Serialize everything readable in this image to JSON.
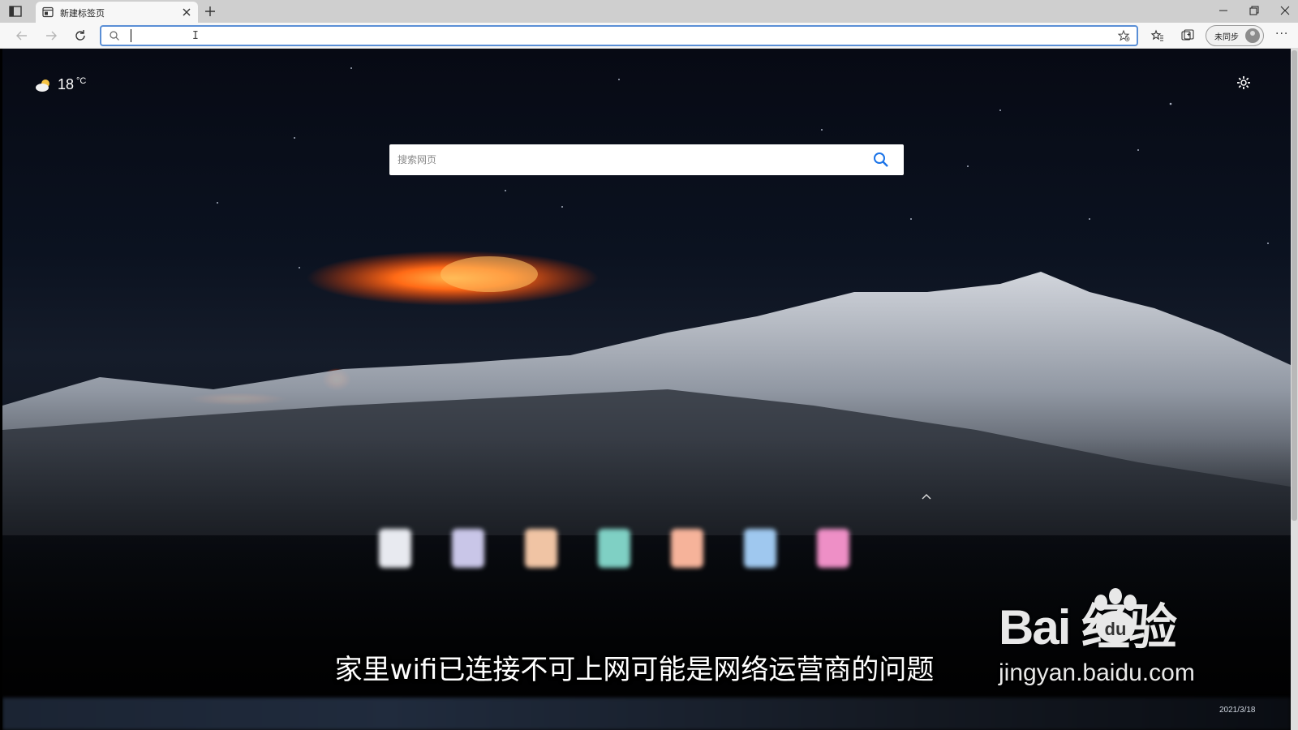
{
  "browser": {
    "tab": {
      "title": "新建标签页"
    },
    "address_bar": {
      "value": "",
      "cursor": "I"
    },
    "profile": {
      "label": "未同步"
    },
    "more": "···"
  },
  "newtab": {
    "weather": {
      "temperature": "18",
      "unit": "°C",
      "icon": "partly-cloudy-icon"
    },
    "search": {
      "placeholder": "搜索网页"
    },
    "quick_links": [
      "#e8eaf0",
      "#c9c6e8",
      "#f0c4a4",
      "#7fd0c4",
      "#f6b39a",
      "#9fc8ef",
      "#ee8fc6"
    ]
  },
  "overlay": {
    "subtitle": "家里wifi已连接不可上网可能是网络运营商的问题",
    "watermark_brand": "Bai 经验",
    "watermark_url": "jingyan.baidu.com"
  },
  "taskbar": {
    "date": "2021/3/18"
  }
}
